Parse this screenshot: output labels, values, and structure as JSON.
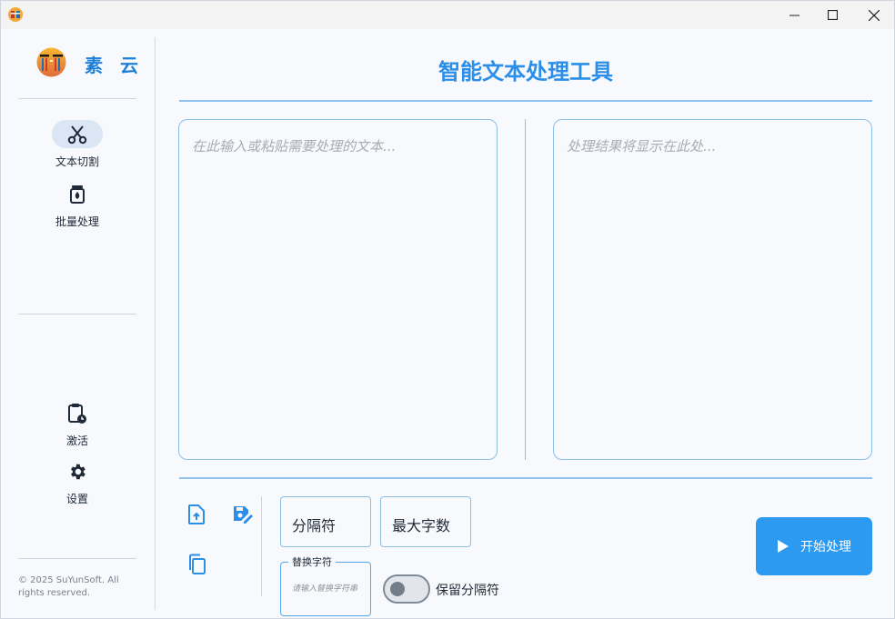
{
  "app": {
    "brand": "素 云",
    "title": "智能文本处理工具"
  },
  "sidebar": {
    "items": [
      {
        "label": "文本切割",
        "icon": "scissors-icon",
        "active": true
      },
      {
        "label": "批量处理",
        "icon": "batch-icon",
        "active": false
      },
      {
        "label": "激活",
        "icon": "clipboard-clock-icon",
        "active": false
      },
      {
        "label": "设置",
        "icon": "gear-icon",
        "active": false
      }
    ],
    "copyright": "© 2025 SuYunSoft. All rights reserved."
  },
  "editor": {
    "input_placeholder": "在此输入或粘贴需要处理的文本...",
    "output_placeholder": "处理结果将显示在此处..."
  },
  "toolbar": {
    "separator_label": "分隔符",
    "max_chars_label": "最大字数",
    "replace_label": "替换字符",
    "replace_placeholder": "请输入替换字符串",
    "keep_separator_label": "保留分隔符",
    "keep_separator_on": false,
    "start_label": "开始处理"
  },
  "colors": {
    "accent": "#2b9af0",
    "title": "#2b8ee8",
    "border": "#8dbfe6"
  }
}
